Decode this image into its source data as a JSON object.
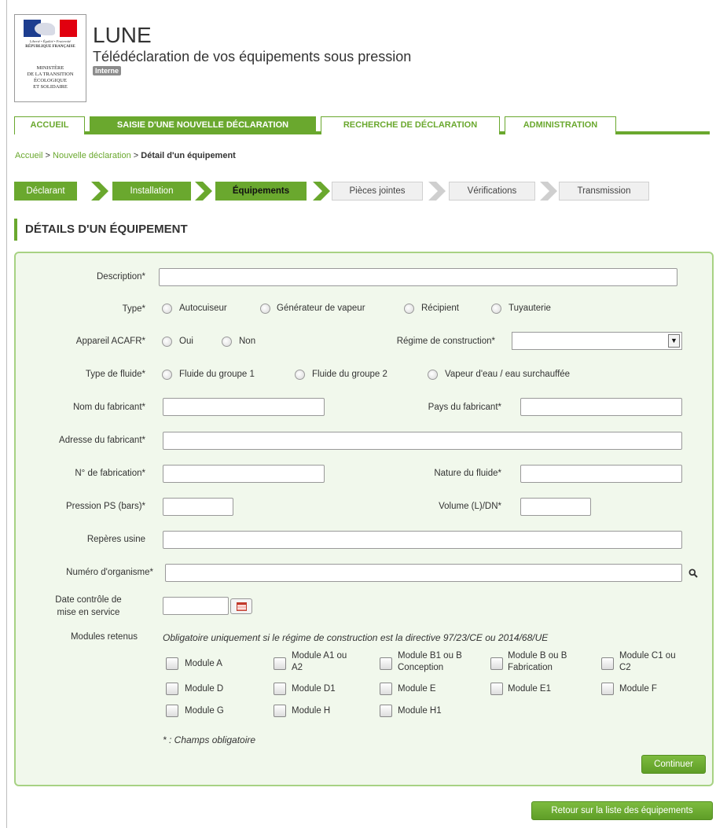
{
  "header": {
    "logo_motto": "Liberté • Égalité • Fraternité",
    "logo_republic": "RÉPUBLIQUE FRANÇAISE",
    "ministry_lines": [
      "MINISTÈRE",
      "DE LA TRANSITION",
      "ÉCOLOGIQUE",
      "ET SOLIDAIRE"
    ],
    "app_title": "LUNE",
    "app_subtitle": "Télédéclaration de vos équipements sous pression",
    "badge": "Interne"
  },
  "tabs": [
    {
      "label": "ACCUEIL",
      "active": false
    },
    {
      "label": "SAISIE D'UNE NOUVELLE DÉCLARATION",
      "active": true
    },
    {
      "label": "RECHERCHE DE DÉCLARATION",
      "active": false
    },
    {
      "label": "ADMINISTRATION",
      "active": false
    }
  ],
  "breadcrumb": {
    "home": "Accueil",
    "sep": ">",
    "parent": "Nouvelle déclaration",
    "current": "Détail d'un équipement"
  },
  "steps": [
    {
      "label": "Déclarant",
      "state": "done"
    },
    {
      "label": "Installation",
      "state": "done"
    },
    {
      "label": "Équipements",
      "state": "current"
    },
    {
      "label": "Pièces jointes",
      "state": "todo"
    },
    {
      "label": "Vérifications",
      "state": "todo"
    },
    {
      "label": "Transmission",
      "state": "todo"
    }
  ],
  "section_title": "DÉTAILS D'UN ÉQUIPEMENT",
  "form": {
    "description_label": "Description*",
    "description_value": "",
    "type_label": "Type*",
    "type_options": [
      "Autocuiseur",
      "Générateur de vapeur",
      "Récipient",
      "Tuyauterie"
    ],
    "acafr_label": "Appareil ACAFR*",
    "acafr_options": [
      "Oui",
      "Non"
    ],
    "regime_label": "Régime de construction*",
    "regime_value": "",
    "fluid_type_label": "Type de fluide*",
    "fluid_type_options": [
      "Fluide du groupe 1",
      "Fluide du groupe 2",
      "Vapeur d'eau / eau surchauffée"
    ],
    "manufacturer_name_label": "Nom du fabricant*",
    "manufacturer_country_label": "Pays du fabricant*",
    "manufacturer_address_label": "Adresse du fabricant*",
    "serial_label": "N° de fabrication*",
    "fluid_nature_label": "Nature du fluide*",
    "pressure_label": "Pression PS (bars)*",
    "volume_label": "Volume (L)/DN*",
    "factory_marks_label": "Repères usine",
    "organism_label": "Numéro d'organisme*",
    "date_label_line1": "Date contrôle de",
    "date_label_line2": "mise en service",
    "modules_label": "Modules retenus",
    "modules_note": "Obligatoire uniquement si le régime de construction est la directive 97/23/CE ou 2014/68/UE",
    "modules": [
      [
        "Module A",
        "Module A1 ou A2",
        "Module B1 ou B Conception",
        "Module B ou B Fabrication",
        "Module C1 ou C2"
      ],
      [
        "Module D",
        "Module D1",
        "Module E",
        "Module E1",
        "Module F"
      ],
      [
        "Module G",
        "Module H",
        "Module H1"
      ]
    ],
    "module_labels_split": {
      "a1": [
        "Module A1 ou",
        "A2"
      ],
      "b1": [
        "Module B1 ou B",
        "Conception"
      ],
      "bf": [
        "Module B ou B",
        "Fabrication"
      ],
      "c1": [
        "Module C1 ou",
        "C2"
      ]
    },
    "required_note": "* : Champs obligatoire",
    "continue_button": "Continuer"
  },
  "back_button": "Retour sur la liste des équipements",
  "colors": {
    "accent": "#6aa82e",
    "panel_bg": "#f1f8ec",
    "panel_border": "#a7d283"
  }
}
